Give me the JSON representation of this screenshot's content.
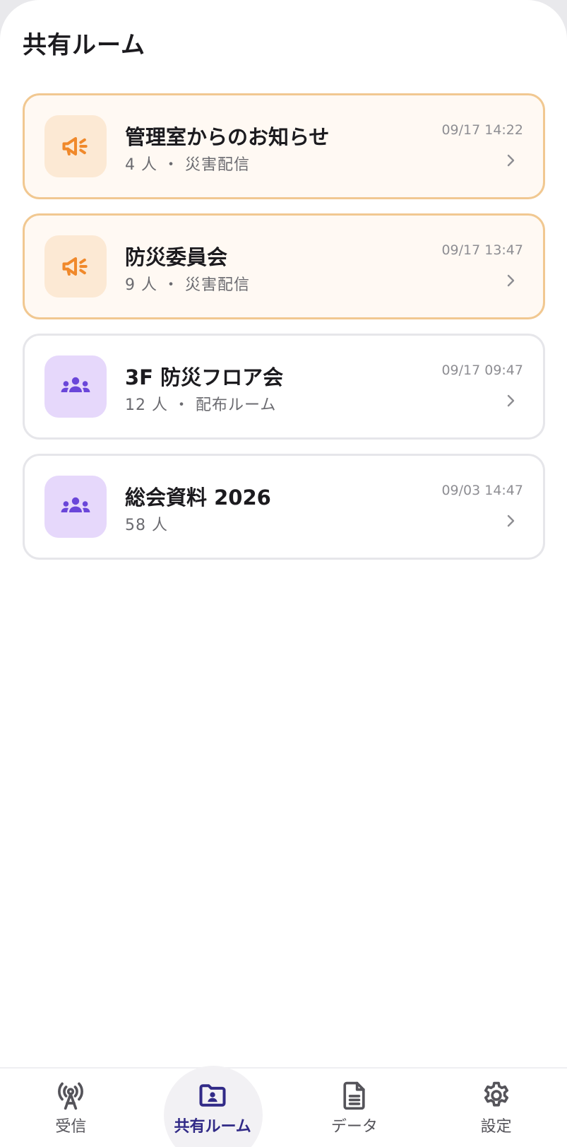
{
  "header": {
    "title": "共有ルーム"
  },
  "rooms": [
    {
      "name": "管理室からのお知らせ",
      "meta": "4 人 ・ 災害配信",
      "time": "09/17 14:22",
      "icon": "megaphone-icon",
      "kind": "alert"
    },
    {
      "name": "防災委員会",
      "meta": "9 人 ・ 災害配信",
      "time": "09/17 13:47",
      "icon": "megaphone-icon",
      "kind": "alert"
    },
    {
      "name": "3F 防災フロア会",
      "meta": "12 人 ・ 配布ルーム",
      "time": "09/17 09:47",
      "icon": "group-icon",
      "kind": "group"
    },
    {
      "name": "総会資料 2026",
      "meta": "58 人",
      "time": "09/03 14:47",
      "icon": "group-icon",
      "kind": "group"
    }
  ],
  "nav": [
    {
      "label": "受信",
      "icon": "antenna-icon",
      "active": false
    },
    {
      "label": "共有ルーム",
      "icon": "shared-folder-icon",
      "active": true
    },
    {
      "label": "データ",
      "icon": "document-icon",
      "active": false
    },
    {
      "label": "設定",
      "icon": "gear-icon",
      "active": false
    }
  ],
  "colors": {
    "alert_accent": "#f0892b",
    "alert_border": "#f1c891",
    "group_accent": "#6a46d9",
    "nav_active": "#312a87"
  }
}
